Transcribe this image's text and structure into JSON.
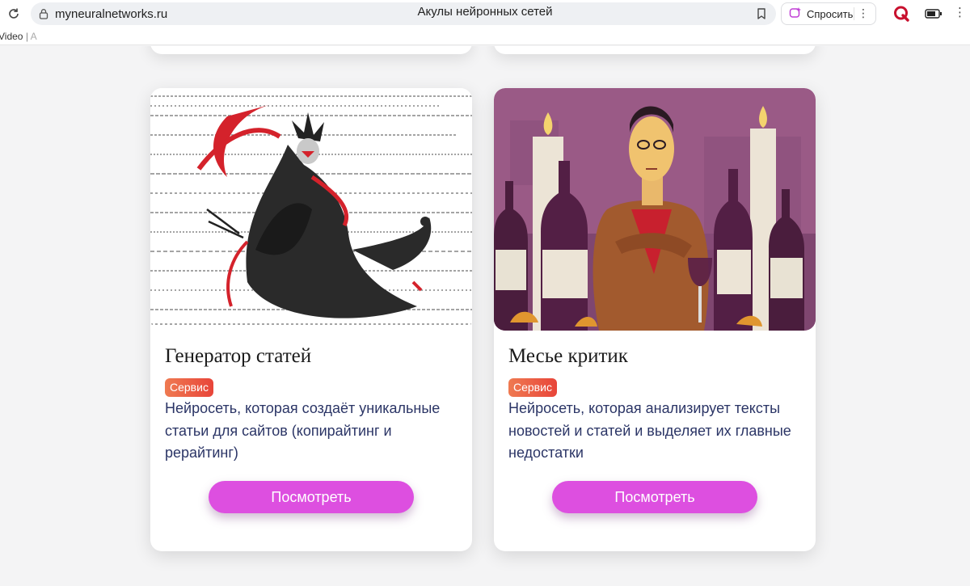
{
  "browser": {
    "url": "myneuralnetworks.ru",
    "tab_title": "Акулы нейронных сетей",
    "ask_label": "Спросить",
    "extension_letter": "Q"
  },
  "bookmarks": {
    "first": "Video",
    "separator": "|",
    "next": "A"
  },
  "cards": [
    {
      "title": "Генератор статей",
      "badge": "Сервис",
      "description": "Нейросеть, которая создаёт уникальные статьи для сайтов (копирайтинг и рерайтинг)",
      "button": "Посмотреть"
    },
    {
      "title": "Месье критик",
      "badge": "Сервис",
      "description": "Нейросеть, которая анализирует тексты новостей и статей и выделяет их главные недостатки",
      "button": "Посмотреть"
    }
  ],
  "colors": {
    "button": "#dd4fe0",
    "badge_start": "#ef7a51",
    "badge_end": "#e8453a",
    "description": "#2b3566"
  }
}
